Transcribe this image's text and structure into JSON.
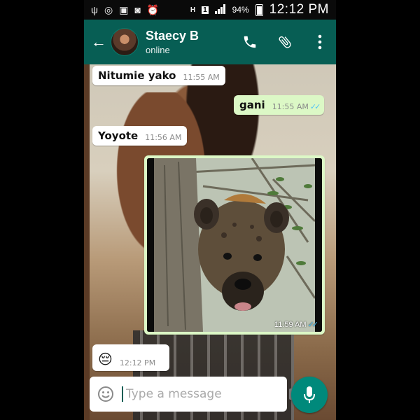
{
  "status_bar": {
    "battery": "94%",
    "time": "12:12 PM",
    "icons": [
      "usb-icon",
      "whatsapp-icon",
      "gallery-icon",
      "alarm-icon",
      "hd-icon",
      "sim-1-icon",
      "signal-icon",
      "battery-icon"
    ]
  },
  "header": {
    "contact_name": "Staecy B",
    "contact_status": "online",
    "actions": [
      "call-icon",
      "attach-icon",
      "more-icon"
    ]
  },
  "messages": [
    {
      "direction": "in",
      "text": "Nitumie yako",
      "time": "11:55 AM"
    },
    {
      "direction": "out",
      "text": "gani",
      "time": "11:55 AM",
      "read": true
    },
    {
      "direction": "in",
      "text": "Yoyote",
      "time": "11:56 AM"
    },
    {
      "direction": "out",
      "type": "image",
      "subject": "hyena-photo",
      "time": "11:59 AM",
      "read": true
    },
    {
      "direction": "in",
      "text": "😔",
      "time": "12:12 PM"
    }
  ],
  "input": {
    "placeholder": "Type a message"
  },
  "colors": {
    "header_bg": "#075e54",
    "outgoing_bubble": "#dcf8c6",
    "incoming_bubble": "#ffffff",
    "read_ticks": "#4fc3f7",
    "mic_button": "#00897b"
  }
}
